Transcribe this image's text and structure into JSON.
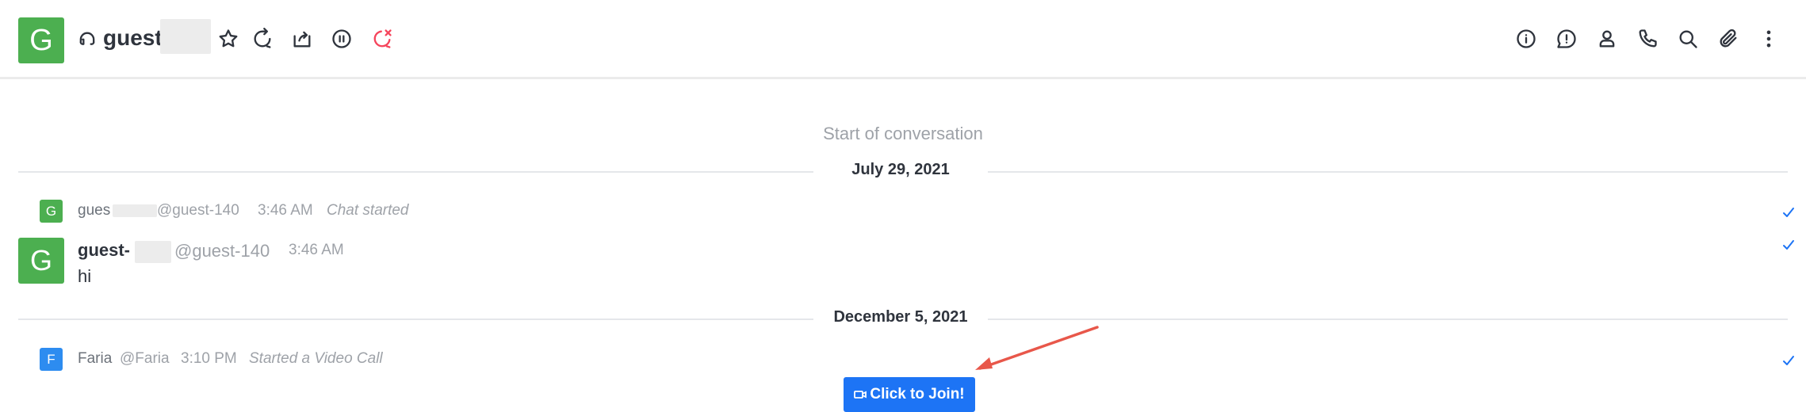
{
  "header": {
    "avatar_letter": "G",
    "room_name": "guest",
    "avatar_color": "#4caf50",
    "left_icons": [
      "headset-icon",
      "star-icon",
      "forward-chat-icon",
      "move-to-queue-icon",
      "pause-icon",
      "close-chat-icon"
    ],
    "right_icons": [
      "info-icon",
      "alert-icon",
      "user-icon",
      "phone-icon",
      "search-icon",
      "attachment-icon",
      "kebab-menu-icon"
    ],
    "close_icon_color": "#f5455c"
  },
  "conversation": {
    "start_label": "Start of conversation",
    "dividers": [
      {
        "label": "July 29, 2021"
      },
      {
        "label": "December 5, 2021"
      }
    ],
    "messages": [
      {
        "avatar": "G",
        "name": "gues",
        "username": "@guest-140",
        "time": "3:46 AM",
        "system_text": "Chat started",
        "avatar_color": "#4caf50"
      },
      {
        "avatar": "G",
        "name": "guest-",
        "username": "@guest-140",
        "time": "3:46 AM",
        "text": "hi",
        "avatar_color": "#4caf50"
      },
      {
        "avatar": "F",
        "name": "Faria",
        "username": "@Faria",
        "time": "3:10 PM",
        "system_text": "Started a Video Call",
        "avatar_color": "#2d8cf0"
      }
    ],
    "join_button": "Click to Join!",
    "accent_color": "#1d74f5",
    "annotation_arrow_color": "#e8574a"
  }
}
